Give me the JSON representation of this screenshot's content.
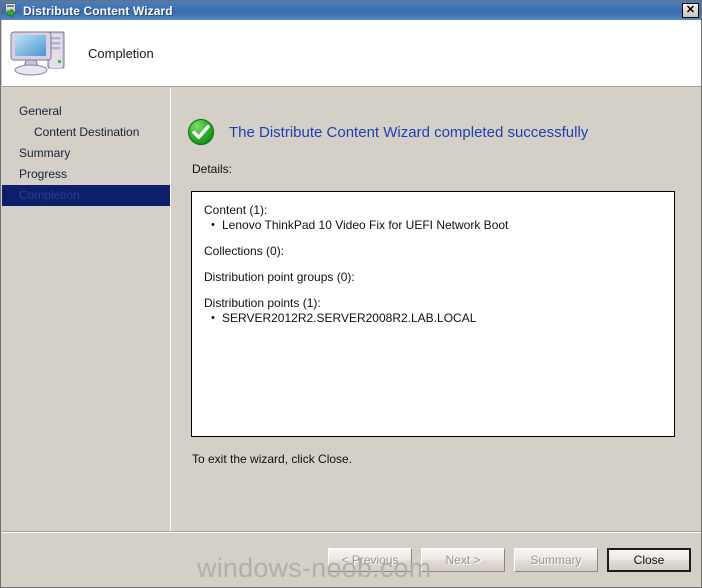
{
  "window": {
    "title": "Distribute Content Wizard",
    "title_icon": "distribute-content-icon",
    "close_label": "✕"
  },
  "header": {
    "title": "Completion",
    "icon": "computer-icon"
  },
  "sidebar": {
    "items": [
      {
        "label": "General",
        "sub": false,
        "selected": false
      },
      {
        "label": "Content Destination",
        "sub": true,
        "selected": false
      },
      {
        "label": "Summary",
        "sub": false,
        "selected": false
      },
      {
        "label": "Progress",
        "sub": false,
        "selected": false
      },
      {
        "label": "Completion",
        "sub": false,
        "selected": true
      }
    ]
  },
  "main": {
    "status_icon": "success-check-icon",
    "status_text": "The Distribute Content Wizard completed successfully",
    "details_label": "Details:",
    "details": [
      {
        "heading": "Content (1):",
        "items": [
          "Lenovo ThinkPad 10 Video Fix for UEFI Network Boot"
        ]
      },
      {
        "heading": "Collections (0):",
        "items": []
      },
      {
        "heading": "Distribution point groups (0):",
        "items": []
      },
      {
        "heading": "Distribution points (1):",
        "items": [
          "SERVER2012R2.SERVER2008R2.LAB.LOCAL"
        ]
      }
    ],
    "exit_note": "To exit the wizard, click Close."
  },
  "footer": {
    "buttons": [
      {
        "label": "< Previous",
        "disabled": true,
        "default": false
      },
      {
        "label": "Next >",
        "disabled": true,
        "default": false
      },
      {
        "label": "Summary",
        "disabled": true,
        "default": false
      },
      {
        "label": "Close",
        "disabled": false,
        "default": true
      }
    ]
  },
  "watermark": {
    "text": "windows-noob.com"
  },
  "colors": {
    "titlebar_blue": "#3e72b3",
    "window_gray": "#d4d0c8",
    "selected_navy": "#0b1f6b",
    "heading_blue": "#1d3fb0",
    "success_green": "#2aa32a",
    "watermark_gray": "#b3afa7"
  }
}
